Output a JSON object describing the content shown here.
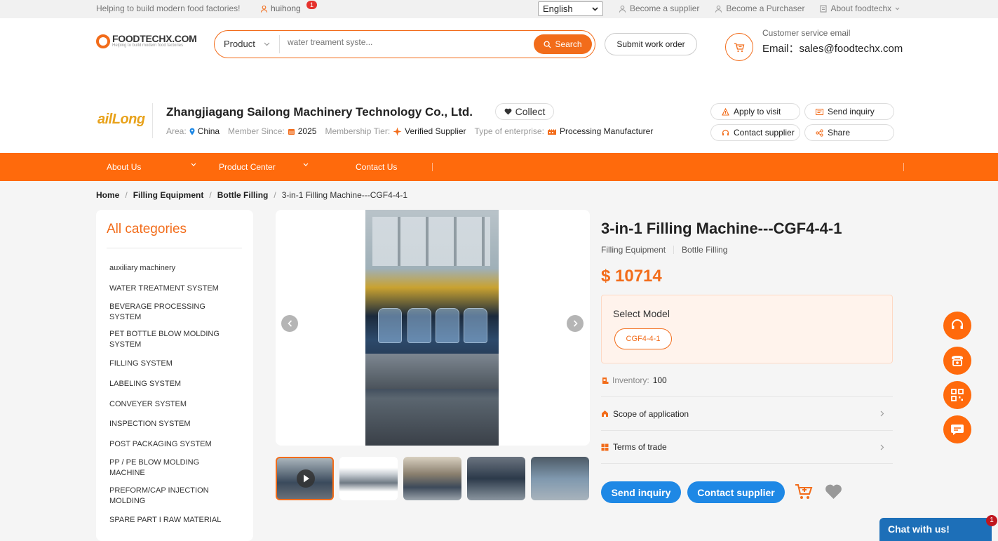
{
  "topbar": {
    "slogan": "Helping to build modern food factories!",
    "username": "huihong",
    "notif_count": "1",
    "language": "English",
    "links": [
      "Become a supplier",
      "Become a Purchaser",
      "About foodtechx"
    ]
  },
  "header": {
    "logo_text": "FOODTECHX.COM",
    "logo_sub": "Helping to build modern food factories",
    "search_category": "Product",
    "search_placeholder": "water treament syste...",
    "search_button": "Search",
    "work_order": "Submit work order",
    "cs_label": "Customer service email",
    "cs_email": "Email：sales@foodtechx.com"
  },
  "company": {
    "logo_text": "ailLong",
    "name": "Zhangjiagang Sailong Machinery Technology Co., Ltd.",
    "collect": "Collect",
    "area_label": "Area:",
    "area_value": "China",
    "member_label": "Member Since:",
    "member_value": "2025",
    "tier_label": "Membership Tier:",
    "tier_value": "Verified Supplier",
    "type_label": "Type of enterprise:",
    "type_value": "Processing Manufacturer",
    "actions": [
      "Apply to visit",
      "Send inquiry",
      "Contact supplier",
      "Share"
    ]
  },
  "nav": {
    "items": [
      "About Us",
      "Product Center",
      "Contact Us"
    ]
  },
  "breadcrumb": {
    "home": "Home",
    "level1": "Filling Equipment",
    "level2": "Bottle Filling",
    "current": "3-in-1 Filling Machine---CGF4-4-1"
  },
  "categories": {
    "title": "All categories",
    "items": [
      "auxiliary machinery",
      "WATER TREATMENT SYSTEM",
      "BEVERAGE PROCESSING SYSTEM",
      "PET BOTTLE BLOW MOLDING SYSTEM",
      "FILLING SYSTEM",
      "LABELING SYSTEM",
      "CONVEYER SYSTEM",
      "INSPECTION SYSTEM",
      "POST PACKAGING SYSTEM",
      "PP / PE BLOW MOLDING MACHINE",
      "PREFORM/CAP INJECTION MOLDING",
      "SPARE PART I RAW MATERIAL"
    ]
  },
  "product": {
    "title": "3-in-1 Filling Machine---CGF4-4-1",
    "category1": "Filling Equipment",
    "category2": "Bottle Filling",
    "price": "$ 10714",
    "select_model_label": "Select Model",
    "model_option": "CGF4-4-1",
    "inventory_label": "Inventory:",
    "inventory_value": "100",
    "scope_label": "Scope of application",
    "terms_label": "Terms of trade",
    "send_inquiry": "Send inquiry",
    "contact_supplier": "Contact supplier"
  },
  "chat": {
    "label": "Chat with us!",
    "badge": "1"
  },
  "colors": {
    "accent": "#ff6a0c",
    "blue": "#1e88e5",
    "chat": "#1d6fb8"
  }
}
